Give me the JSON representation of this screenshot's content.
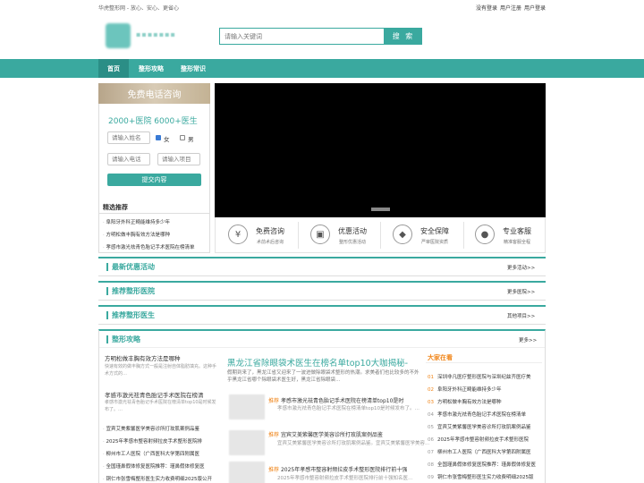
{
  "topbar": {
    "tagline": "华虎整形网 - 放心、安心、更省心",
    "links": [
      "没有登录",
      "用户注册",
      "用户登录"
    ]
  },
  "search": {
    "placeholder": "请输入关键词",
    "button": "搜 索"
  },
  "nav": [
    "首页",
    "整形攻略",
    "整形常识"
  ],
  "sidebar": {
    "banner": "免费电话咨询",
    "promo": "2000+医院 6000+医生",
    "name_placeholder": "请输入姓名",
    "gender_female": "女",
    "gender_male": "男",
    "phone_placeholder": "请输入电话",
    "project_placeholder": "请输入项目",
    "submit": "提交内容",
    "rec_title": "精选推荐",
    "rec_items": [
      "阜阳牙外科正畸能维持多少年",
      "方明松做丰胸有效方法是哪种",
      "孝感市激光祛青色胎记手术医院在榜清单"
    ]
  },
  "features": [
    {
      "icon": "yen-icon",
      "glyph": "¥",
      "title": "免费咨询",
      "sub": "术前术后咨询"
    },
    {
      "icon": "gift-icon",
      "glyph": "▣",
      "title": "优惠活动",
      "sub": "整形优惠活动"
    },
    {
      "icon": "shield-icon",
      "glyph": "◆",
      "title": "安全保障",
      "sub": "严审医院资质"
    },
    {
      "icon": "service-icon",
      "glyph": "●",
      "title": "专业客服",
      "sub": "精准客服全程"
    }
  ],
  "sections": [
    {
      "title": "最新优惠活动",
      "more": "更多活动>>"
    },
    {
      "title": "推荐整形医院",
      "more": "更多医院>>"
    },
    {
      "title": "推荐整形医生",
      "more": "其他项目>>"
    }
  ],
  "guide": {
    "title": "整形攻略",
    "more": "更多>>",
    "left_a_title": "方明松做丰胸有效方法是哪种",
    "left_a_desc": "快速有效的做丰胸方式一般是注射自体脂肪填充。这种手术方式的…",
    "left_b_title": "孝感市激光祛青色胎记手术医院在榜清",
    "left_b_desc": "孝感市激光祛青色胎记手术医院在榜清单top10是时候发布了。…",
    "mini_items": [
      "宜宾艾美紫馨医学美容诊所打玫肌案例品鉴",
      "2025年孝感市整容射频拉皮手术整形医院排",
      "柳州市工人医院（广西医科大学第四附属医",
      "全国瑾鼻假体修复医院推荐：瑾鼻假体修复医",
      "铜仁市张雪梅整形医生实力收费明细2025版公开"
    ],
    "featured_title": "黑龙江省除眼袋术医生在榜名单top10大咖揭秘-",
    "featured_desc": "假期到来了，黑龙江省又迎来了一波进做除眼袋术整形的热潮。求美者们也比较多的不外乎黑龙江省哪个除眼袋术医生好，黑龙江省除眼袋…",
    "news": [
      {
        "tag": "推荐",
        "title": "孝感市激光祛青色胎记手术医院在榜清单top10是时",
        "desc": "孝感市激光祛青色胎记手术医院在榜清单top10是时候发布了。…"
      },
      {
        "tag": "推荐",
        "title": "宜宾艾美紫馨医学美容诊所打玫肌案例品鉴",
        "desc": "宜宾艾美紫馨医学美容诊所打玫肌案例品鉴。宜宾艾美紫馨医学美容…"
      },
      {
        "tag": "推荐",
        "title": "2025年孝感市整容射频拉皮手术整形医院排行前十强",
        "desc": "2025年孝感市整容射频拉皮手术整形医院排行前十强知名医…"
      }
    ],
    "rank_title": "大家在看",
    "rank_items": [
      {
        "num": "01",
        "text": "深圳非凡医疗整形医院与深圳纪兹齐医疗美"
      },
      {
        "num": "02",
        "text": "阜阳牙外科正畸能维持多少年"
      },
      {
        "num": "03",
        "text": "方明松做丰胸有效方法是哪种"
      },
      {
        "num": "04",
        "text": "孝感市激光祛青色胎记手术医院在榜清单"
      },
      {
        "num": "05",
        "text": "宜宾艾美紫馨医学美容诊所打玫肌案例品鉴"
      },
      {
        "num": "06",
        "text": "2025年孝感市整容射频拉皮手术整形医院"
      },
      {
        "num": "07",
        "text": "柳州市工人医院（广西医科大学第四附属医"
      },
      {
        "num": "08",
        "text": "全国瑾鼻假体修复医院推荐：瑾鼻假体修复医"
      },
      {
        "num": "09",
        "text": "铜仁市张雪梅整形医生实力收费明细2025版"
      }
    ]
  }
}
